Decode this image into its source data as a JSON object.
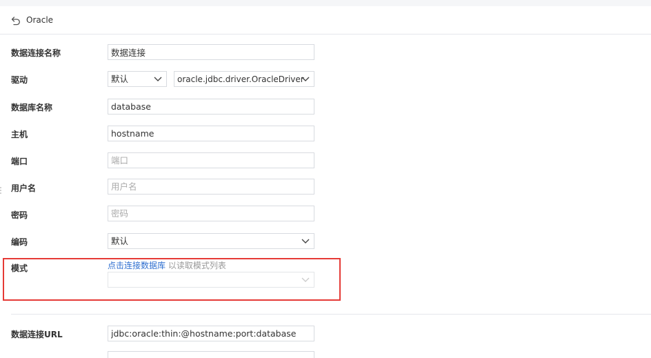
{
  "header": {
    "title": "Oracle",
    "back_icon": "undo-arrow-icon"
  },
  "form": {
    "connection_name": {
      "label": "数据连接名称",
      "value": "数据连接"
    },
    "driver": {
      "label": "驱动",
      "mode_value": "默认",
      "driver_value": "oracle.jdbc.driver.OracleDriver"
    },
    "database_name": {
      "label": "数据库名称",
      "value": "database"
    },
    "host": {
      "label": "主机",
      "value": "hostname"
    },
    "port": {
      "label": "端口",
      "placeholder": "端口"
    },
    "username": {
      "label": "用户名",
      "placeholder": "用户名"
    },
    "password": {
      "label": "密码",
      "placeholder": "密码"
    },
    "encoding": {
      "label": "编码",
      "value": "默认"
    },
    "schema": {
      "label": "模式",
      "link_text": "点击连接数据库",
      "hint_text": " 以读取模式列表",
      "value": ""
    },
    "url": {
      "label": "数据连接URL",
      "value": "jdbc:oracle:thin:@hostname:port:database"
    }
  },
  "colors": {
    "link": "#2f6fd0",
    "highlight_border": "#e53935",
    "field_border": "#d8dbe0",
    "label_text": "#333333",
    "placeholder_text": "#aaaaaa"
  }
}
